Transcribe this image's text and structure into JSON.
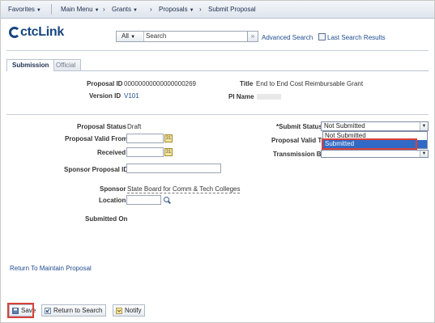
{
  "nav": {
    "favorites": "Favorites",
    "main_menu": "Main Menu",
    "breadcrumb": [
      "Grants",
      "Proposals",
      "Submit Proposal"
    ]
  },
  "brand": {
    "logo_text": "ctcLink"
  },
  "search": {
    "scope": "All",
    "placeholder": "Search",
    "advanced_label": "Advanced Search",
    "last_results_label": "Last Search Results"
  },
  "tabs": [
    {
      "label": "Submission",
      "active": true
    },
    {
      "label": "Official",
      "active": false
    }
  ],
  "header": {
    "proposal_id_label": "Proposal ID",
    "proposal_id": "00000000000000000269",
    "title_label": "Title",
    "title": "End to End Cost Reimbursable Grant",
    "version_id_label": "Version ID",
    "version_id": "V101",
    "pi_name_label": "PI Name"
  },
  "form": {
    "proposal_status_label": "Proposal Status",
    "proposal_status": "Draft",
    "valid_from_label": "Proposal Valid From",
    "valid_from": "",
    "received_label": "Received",
    "received": "",
    "sponsor_proposal_id_label": "Sponsor Proposal ID",
    "sponsor_proposal_id": "",
    "sponsor_label": "Sponsor",
    "sponsor": "State Board for Comm & Tech Colleges",
    "location_label": "Location",
    "location": "",
    "submitted_on_label": "Submitted On",
    "submit_status_label": "*Submit Status",
    "submit_status": "Not Submitted",
    "submit_status_options": [
      "Not Submitted",
      "Submitted"
    ],
    "highlighted_option": "Submitted",
    "valid_to_label": "Proposal Valid To",
    "transmission_by_label": "Transmission By"
  },
  "links": {
    "return_to_maintain": "Return To Maintain Proposal"
  },
  "toolbar": {
    "save": "Save",
    "return_to_search": "Return to Search",
    "notify": "Notify"
  },
  "colors": {
    "accent": "#1f4c8f",
    "highlight": "#d9403a",
    "selected_option": "#316ac5"
  }
}
